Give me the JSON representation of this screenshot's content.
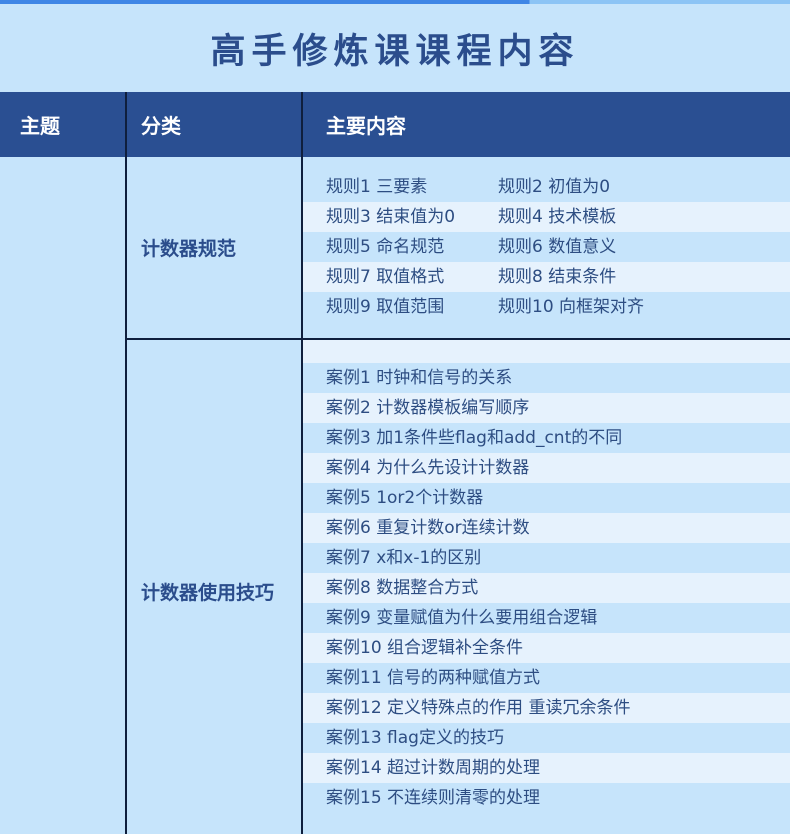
{
  "title": "高手修炼课课程内容",
  "colors": {
    "background": "#c6e4fb",
    "header": "#2a4f92",
    "title": "#2b4d8c",
    "stripe": "#e6f2fd"
  },
  "header": {
    "col1": "主题",
    "col2": "分类",
    "col3": "主要内容"
  },
  "categories": {
    "spec": "计数器规范",
    "usage": "计数器使用技巧"
  },
  "rules": [
    [
      "规则1 三要素",
      "规则2 初值为0"
    ],
    [
      "规则3 结束值为0",
      "规则4 技术模板"
    ],
    [
      "规则5 命名规范",
      "规则6 数值意义"
    ],
    [
      "规则7 取值格式",
      "规则8 结束条件"
    ],
    [
      "规则9 取值范围",
      "规则10 向框架对齐"
    ]
  ],
  "cases": [
    "案例1 时钟和信号的关系",
    "案例2 计数器模板编写顺序",
    "案例3 加1条件些flag和add_cnt的不同",
    "案例4 为什么先设计计数器",
    "案例5 1or2个计数器",
    "案例6 重复计数or连续计数",
    "案例7 x和x-1的区别",
    "案例8 数据整合方式",
    "案例9 变量赋值为什么要用组合逻辑",
    "案例10 组合逻辑补全条件",
    "案例11 信号的两种赋值方式",
    "案例12 定义特殊点的作用 重读冗余条件",
    "案例13 flag定义的技巧",
    "案例14 超过计数周期的处理",
    "案例15 不连续则清零的处理"
  ]
}
